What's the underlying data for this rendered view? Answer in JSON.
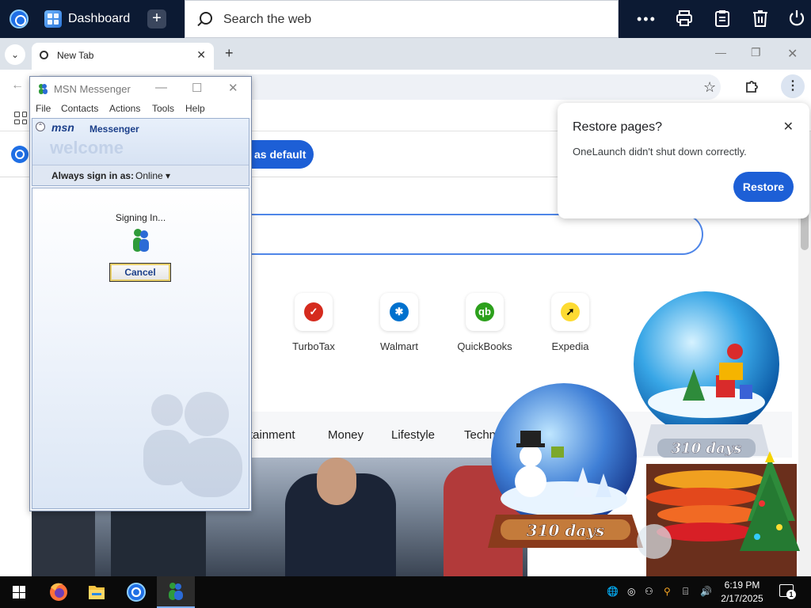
{
  "topbar": {
    "dashboard_label": "Dashboard",
    "search_placeholder": "Search the web"
  },
  "browser": {
    "tab_title": "New Tab",
    "set_default_label": "as default",
    "tiles": [
      {
        "label": "TurboTax",
        "icon": "check-icon",
        "color": "#d52b1e"
      },
      {
        "label": "Walmart",
        "icon": "walmart-spark-icon",
        "color": "#0071ce"
      },
      {
        "label": "QuickBooks",
        "icon": "qb-icon",
        "color": "#2ca01c"
      },
      {
        "label": "Expedia",
        "icon": "arrow-icon",
        "color": "#fddb32"
      }
    ],
    "nav": [
      "rtainment",
      "Money",
      "Lifestyle",
      "Techn"
    ]
  },
  "restore_popup": {
    "title": "Restore pages?",
    "message": "OneLaunch didn't shut down correctly.",
    "button": "Restore"
  },
  "msn": {
    "title": "MSN Messenger",
    "menu": [
      "File",
      "Contacts",
      "Actions",
      "Tools",
      "Help"
    ],
    "brand": "msn",
    "brand_product": "Messenger",
    "welcome": "welcome",
    "sign_in_label": "Always sign in as:",
    "status": "Online",
    "signing_in": "Signing In...",
    "cancel": "Cancel"
  },
  "globes": {
    "left_label": "310 days",
    "right_label": "310 days"
  },
  "taskbar": {
    "time": "6:19 PM",
    "date": "2/17/2025",
    "notification_count": "1"
  },
  "colors": {
    "accent_blue": "#1d5fd6",
    "topbar_bg": "#0c1a33",
    "taskbar_bg": "#0a0a0a"
  }
}
